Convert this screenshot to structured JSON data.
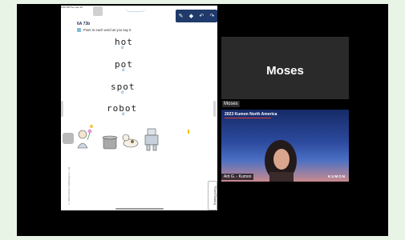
{
  "tablet": {
    "status_bar": "2:00 PM  Tue Jan 16",
    "page_code": "6A 73b",
    "instruction": "Point to each word as you say it.",
    "words": [
      {
        "text": "hot",
        "sub": "d"
      },
      {
        "text": "pot",
        "sub": "d"
      },
      {
        "text": "spot",
        "sub": "d"
      },
      {
        "text": "robot",
        "sub": "d"
      }
    ],
    "side_note": "© 2023 Kumon Publishing Co., Ltd.",
    "vertical_tab": "Fluent Reading"
  },
  "participants": {
    "name_tile": {
      "display_name": "Moses",
      "label": "Moses"
    },
    "video_tile": {
      "banner_title": "2023 Kumon North America",
      "caption": "Arti G. - Kumon",
      "logo": "KUMON"
    }
  },
  "colors": {
    "toolbar": "#1f3a6b",
    "accent_red": "#e03a3a",
    "link_blue": "#3a7fc0"
  },
  "icons": [
    "pen-icon",
    "eraser-icon",
    "undo-icon",
    "redo-icon",
    "home-icon"
  ]
}
